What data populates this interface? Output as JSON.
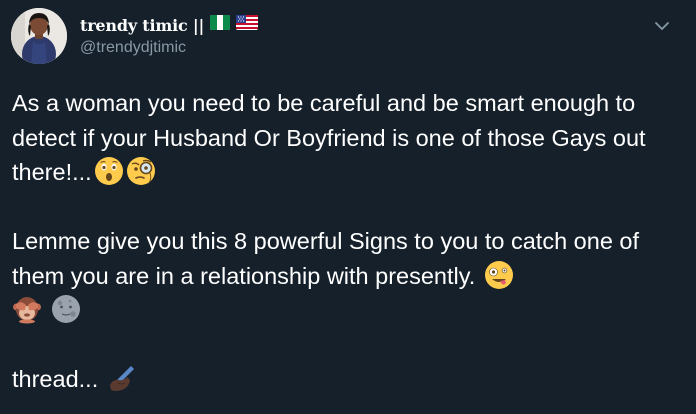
{
  "tweet": {
    "author": {
      "display_name": "trendy timic ||",
      "username": "@trendydjtimic"
    },
    "menu_icon": "chevron-down-icon",
    "paragraphs": {
      "p1": {
        "text": "As a woman you need to be careful and be smart enough to detect if your Husband Or Boyfriend is one of those Gays out there!...",
        "emojis": [
          "astonished-face",
          "face-with-monocle"
        ]
      },
      "p2": {
        "text": "Lemme give you this 8 powerful Signs to you to catch one of them you are in a relationship with presently.",
        "emojis": [
          "zany-face",
          "see-no-evil-monkey",
          "new-moon-face"
        ]
      },
      "p3": {
        "text": "thread...",
        "emojis": [
          "writing-hand-dark-skin"
        ]
      }
    },
    "flags": [
      "nigeria-flag",
      "usa-flag"
    ]
  },
  "colors": {
    "background": "#15202b",
    "text": "#ffffff",
    "secondary_text": "#8899a6"
  }
}
